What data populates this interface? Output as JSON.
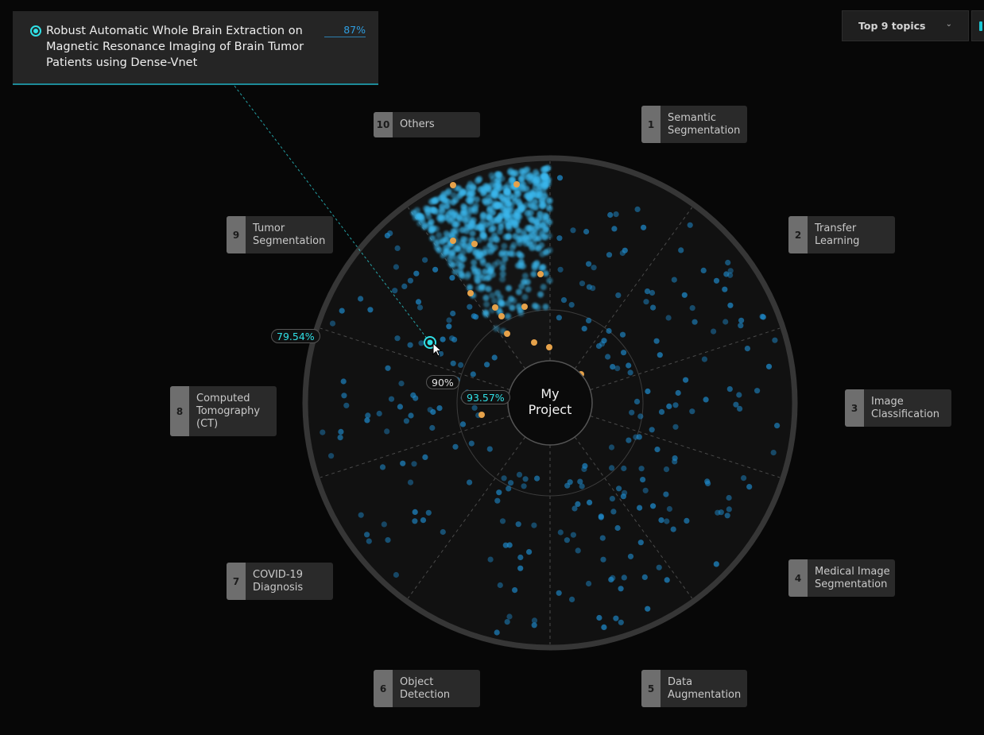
{
  "tooltip": {
    "title": "Robust Automatic Whole Brain Extraction on Magnetic Resonance Imaging of Brain Tumor Patients using Dense-Vnet",
    "score": "87%",
    "score_value": 87,
    "accent": "#30e0e6"
  },
  "topics_selector": {
    "label": "Top 9 topics"
  },
  "center": {
    "label_line1": "My",
    "label_line2": "Project"
  },
  "chart_data": {
    "type": "scatter",
    "layout": "radial",
    "topics": [
      {
        "num": "1",
        "name": "Semantic Segmentation"
      },
      {
        "num": "2",
        "name": "Transfer Learning"
      },
      {
        "num": "3",
        "name": "Image Classification"
      },
      {
        "num": "4",
        "name": "Medical Image Segmentation"
      },
      {
        "num": "5",
        "name": "Data Augmentation"
      },
      {
        "num": "6",
        "name": "Object Detection"
      },
      {
        "num": "7",
        "name": "COVID-19 Diagnosis"
      },
      {
        "num": "8",
        "name": "Computed Tomography (CT)"
      },
      {
        "num": "9",
        "name": "Tumor Segmentation"
      },
      {
        "num": "10",
        "name": "Others"
      }
    ],
    "highlighted_topic": "Others",
    "rings": [
      {
        "label": "90%",
        "value": 90
      },
      {
        "label": "93.57%",
        "value": 93.57
      },
      {
        "label": "79.54%",
        "value": 79.54
      }
    ],
    "colors": {
      "points": "#1e88c8",
      "highlight_points": "#3ab8ee",
      "own_papers": "#e6a24a",
      "selected": "#30e0e6",
      "ring_label_cyan": "#30e0e6",
      "ring_label_white": "#e0e0e0"
    }
  }
}
